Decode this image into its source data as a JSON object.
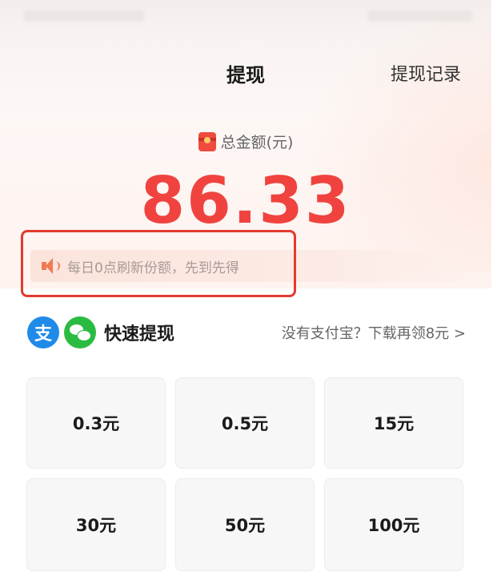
{
  "header": {
    "title": "提现",
    "history_link": "提现记录"
  },
  "balance": {
    "label": "总金额(元)",
    "amount": "86.33",
    "icon": "red-packet-icon"
  },
  "notice": {
    "icon": "speaker-icon",
    "text": "每日0点刷新份额，先到先得"
  },
  "quick_withdraw": {
    "icons": [
      "alipay-icon",
      "wechat-pay-icon"
    ],
    "alipay_glyph": "支",
    "title": "快速提现",
    "promo_link": "没有支付宝？下载再领8元 >"
  },
  "amount_options": [
    "0.3元",
    "0.5元",
    "15元",
    "30元",
    "50元",
    "100元"
  ],
  "colors": {
    "amount_red": "#f0433f",
    "highlight_border": "#e23b2e",
    "alipay_blue": "#1f8ae8",
    "wechat_green": "#2bbb40"
  }
}
